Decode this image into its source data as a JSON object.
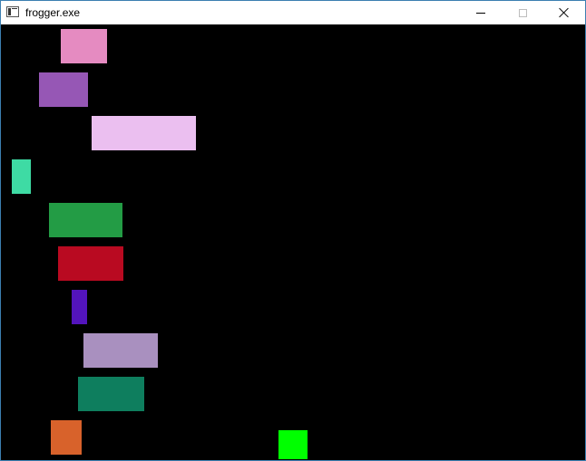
{
  "window": {
    "title": "frogger.exe",
    "icon": "app-console-icon",
    "controls": {
      "minimize": "minimize-icon",
      "maximize": "maximize-icon",
      "close": "close-icon"
    }
  },
  "game": {
    "background_color": "#000000",
    "frog": {
      "color": "#00ff00"
    },
    "cars": [
      {
        "color": "#e58bc1"
      },
      {
        "color": "#9657b5"
      },
      {
        "color": "#ebbff0"
      },
      {
        "color": "#3edba4"
      },
      {
        "color": "#239c45"
      },
      {
        "color": "#b90a21"
      },
      {
        "color": "#5314bc"
      },
      {
        "color": "#a990bf"
      },
      {
        "color": "#0e7e5e"
      },
      {
        "color": "#d8622b"
      }
    ]
  }
}
